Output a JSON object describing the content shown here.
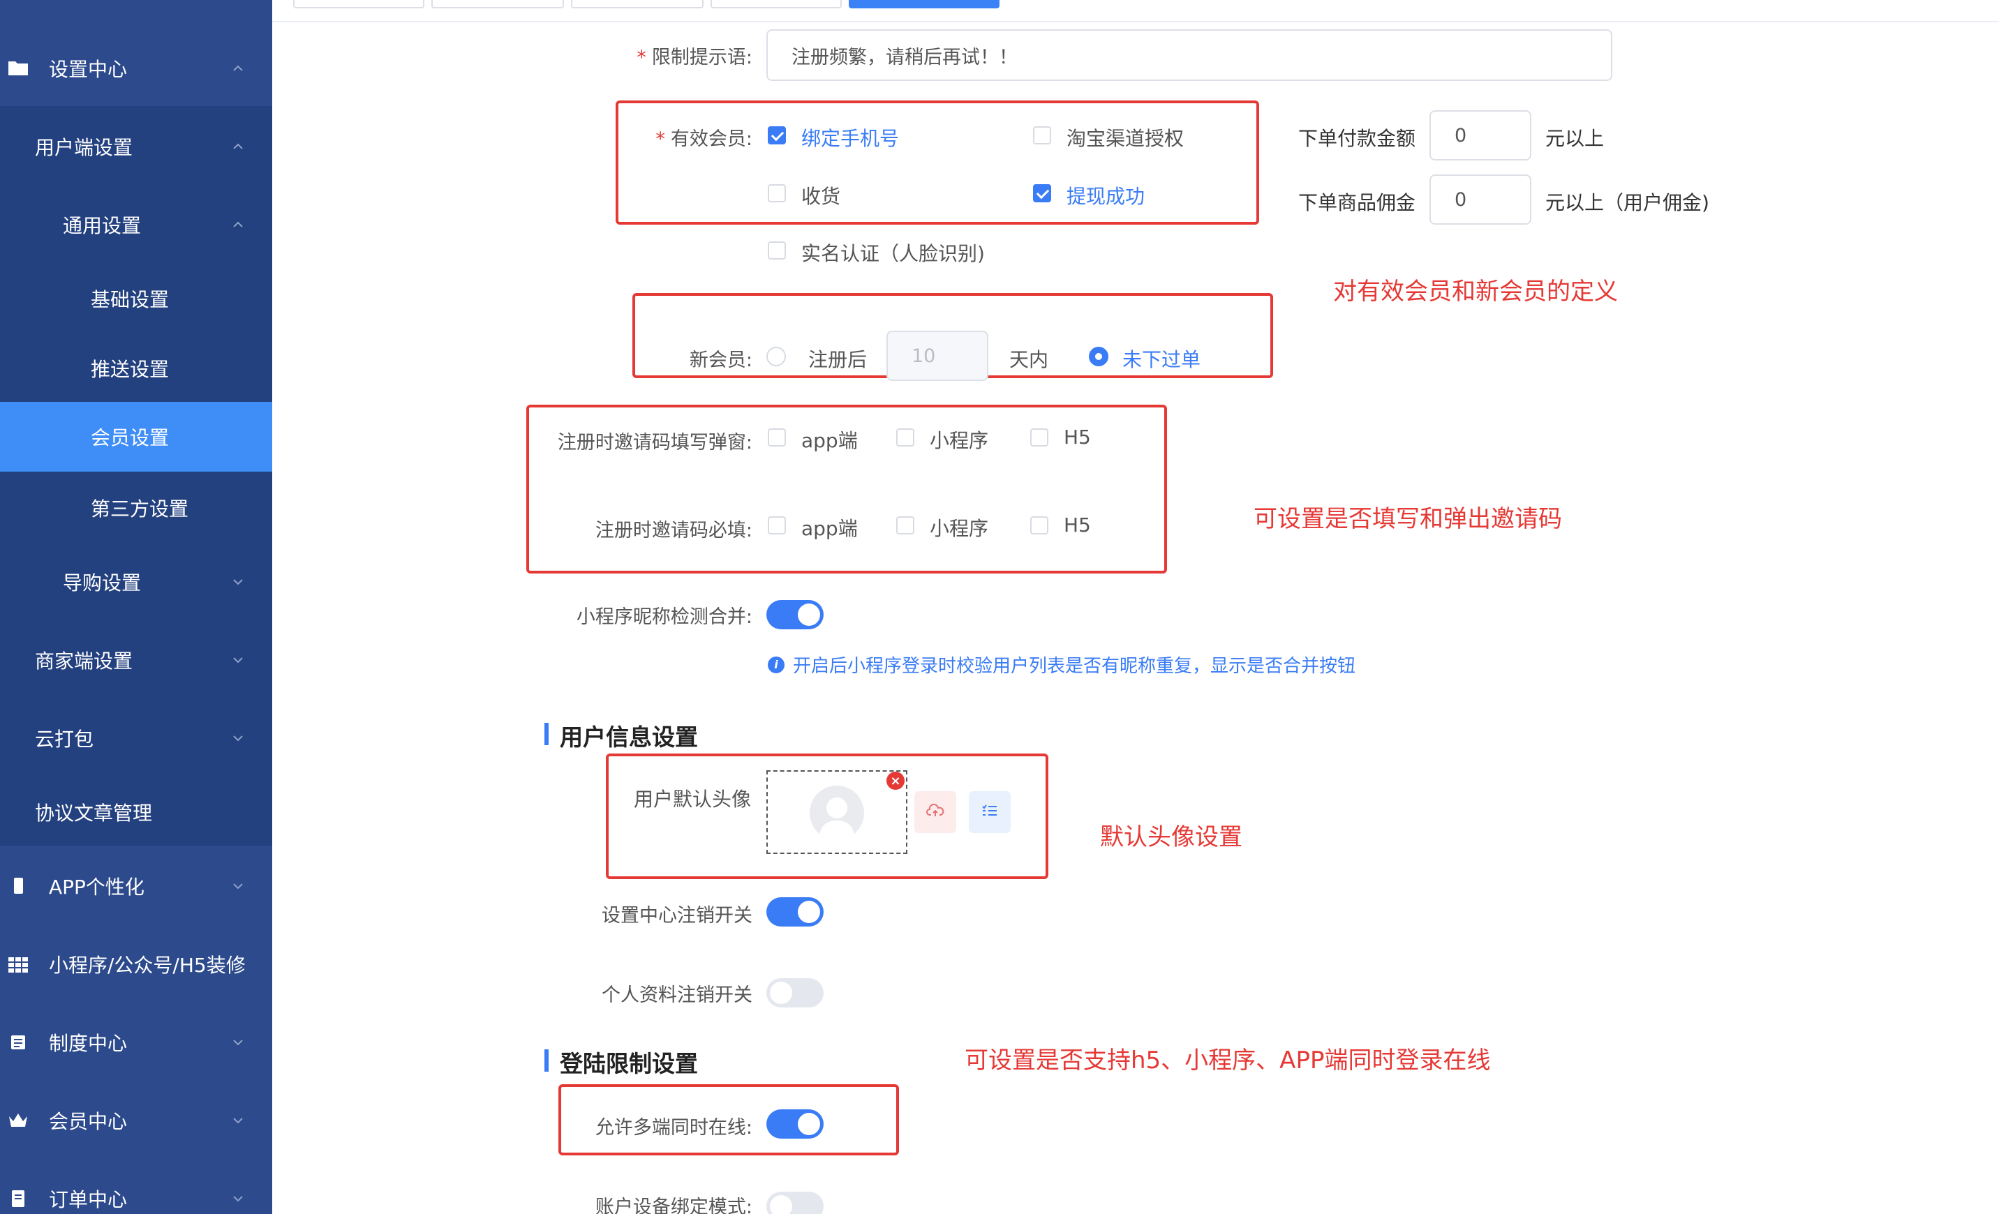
{
  "sidebar": {
    "items": [
      {
        "label": "设置中心",
        "icon": "folder-icon"
      },
      {
        "label": "用户端设置"
      },
      {
        "label": "通用设置"
      },
      {
        "label": "基础设置"
      },
      {
        "label": "推送设置"
      },
      {
        "label": "会员设置",
        "active": true
      },
      {
        "label": "第三方设置"
      },
      {
        "label": "导购设置"
      },
      {
        "label": "商家端设置"
      },
      {
        "label": "云打包"
      },
      {
        "label": "协议文章管理"
      },
      {
        "label": "APP个性化",
        "icon": "phone-icon"
      },
      {
        "label": "小程序/公众号/H5装修",
        "icon": "grid-icon"
      },
      {
        "label": "制度中心",
        "icon": "document-icon"
      },
      {
        "label": "会员中心",
        "icon": "crown-icon"
      },
      {
        "label": "订单中心",
        "icon": "order-icon"
      }
    ]
  },
  "form": {
    "limit_tip": {
      "label": "限制提示语:",
      "value": "注册频繁，请稍后再试！！"
    },
    "valid_member": {
      "label": "有效会员:",
      "options": [
        {
          "label": "绑定手机号",
          "checked": true
        },
        {
          "label": "淘宝渠道授权",
          "checked": false
        },
        {
          "label": "收货",
          "checked": false
        },
        {
          "label": "提现成功",
          "checked": true
        },
        {
          "label": "实名认证（人脸识别)",
          "checked": false
        }
      ],
      "order_amount": {
        "label": "下单付款金额",
        "value": "0",
        "suffix": "元以上"
      },
      "commission": {
        "label": "下单商品佣金",
        "value": "0",
        "suffix": "元以上（用户佣金)"
      }
    },
    "new_member": {
      "label": "新会员:",
      "option1_label": "注册后",
      "days_value": "10",
      "days_suffix": "天内",
      "option2_label": "未下过单"
    },
    "invite_popup": {
      "label": "注册时邀请码填写弹窗:",
      "options": [
        "app端",
        "小程序",
        "H5"
      ]
    },
    "invite_required": {
      "label": "注册时邀请码必填:",
      "options": [
        "app端",
        "小程序",
        "H5"
      ]
    },
    "nickname_merge": {
      "label": "小程序昵称检测合并:",
      "on": true,
      "hint": "开启后小程序登录时校验用户列表是否有昵称重复，显示是否合并按钮"
    },
    "user_info_title": "用户信息设置",
    "default_avatar_label": "用户默认头像",
    "settings_cancel": {
      "label": "设置中心注销开关",
      "on": true
    },
    "profile_cancel": {
      "label": "个人资料注销开关",
      "on": false
    },
    "login_limit_title": "登陆限制设置",
    "multi_online": {
      "label": "允许多端同时在线:",
      "on": true
    },
    "device_bind": {
      "label": "账户设备绑定模式:",
      "on": false
    }
  },
  "notes": {
    "member_def": "对有效会员和新会员的定义",
    "invite": "可设置是否填写和弹出邀请码",
    "avatar": "默认头像设置",
    "login": "可设置是否支持h5、小程序、APP端同时登录在线"
  },
  "colors": {
    "sidebar": "#2c4a8c",
    "sidebar_active": "#3f8ef7",
    "accent": "#3a7cf5",
    "annotation": "#e53935"
  }
}
